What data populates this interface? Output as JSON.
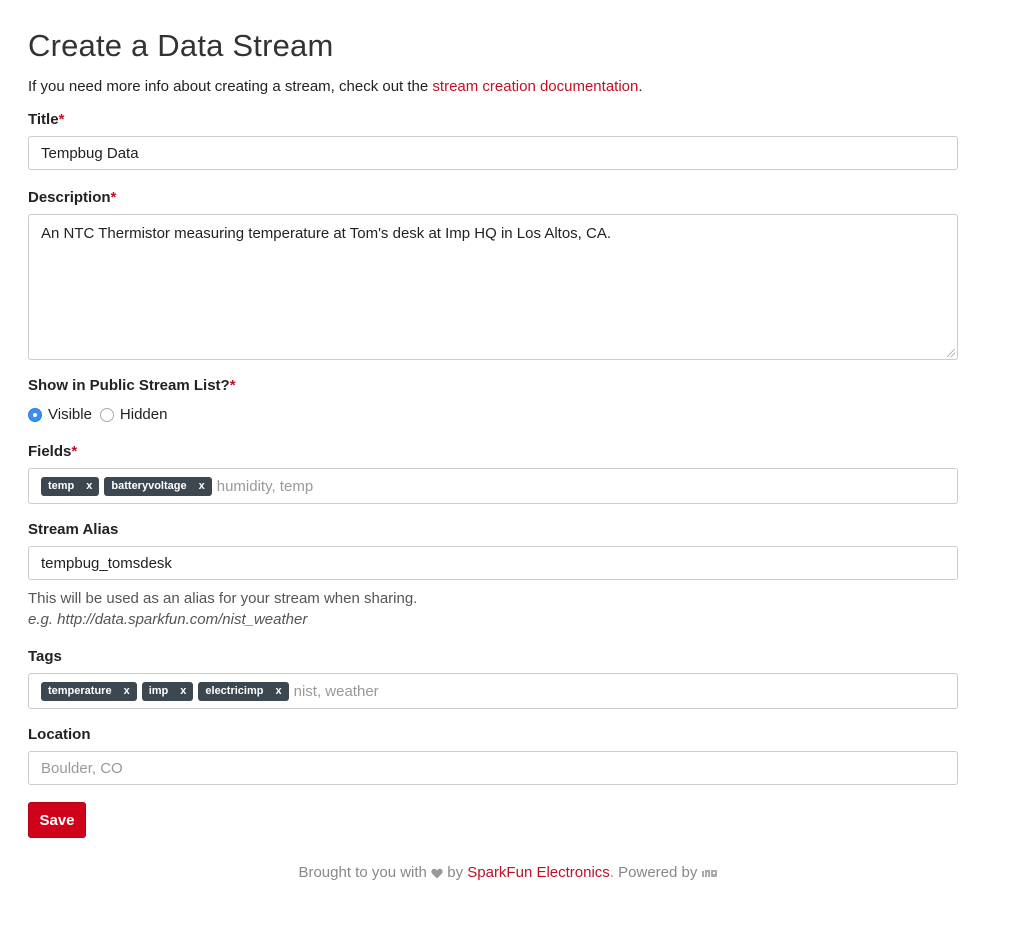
{
  "page": {
    "title": "Create a Data Stream",
    "intro_text": "If you need more info about creating a stream, check out the ",
    "intro_link": "stream creation documentation",
    "intro_end": "."
  },
  "form": {
    "required_mark": "*",
    "title": {
      "label": "Title",
      "value": "Tempbug Data"
    },
    "description": {
      "label": "Description",
      "value": "An NTC Thermistor measuring temperature at Tom's desk at Imp HQ in Los Altos, CA."
    },
    "visibility": {
      "label": "Show in Public Stream List?",
      "options": [
        {
          "label": "Visible",
          "selected": true
        },
        {
          "label": "Hidden",
          "selected": false
        }
      ]
    },
    "fields": {
      "label": "Fields",
      "tags": [
        "temp",
        "batteryvoltage"
      ],
      "placeholder": "humidity, temp"
    },
    "alias": {
      "label": "Stream Alias",
      "value": "tempbug_tomsdesk",
      "help": "This will be used as an alias for your stream when sharing.",
      "example": "e.g. http://data.sparkfun.com/nist_weather"
    },
    "tags": {
      "label": "Tags",
      "tags": [
        "temperature",
        "imp",
        "electricimp"
      ],
      "placeholder": "nist, weather"
    },
    "location": {
      "label": "Location",
      "placeholder": "Boulder, CO"
    },
    "save_label": "Save",
    "tag_remove": "x"
  },
  "footer": {
    "prefix": "Brought to you with",
    "by": "by",
    "link": "SparkFun Electronics",
    "powered": ". Powered by",
    "powered_icon": "imp-logo-icon"
  },
  "colors": {
    "accent": "#c30f25",
    "button": "#d0021b",
    "tag_bg": "#3d474f",
    "radio": "#3b8ef0"
  }
}
